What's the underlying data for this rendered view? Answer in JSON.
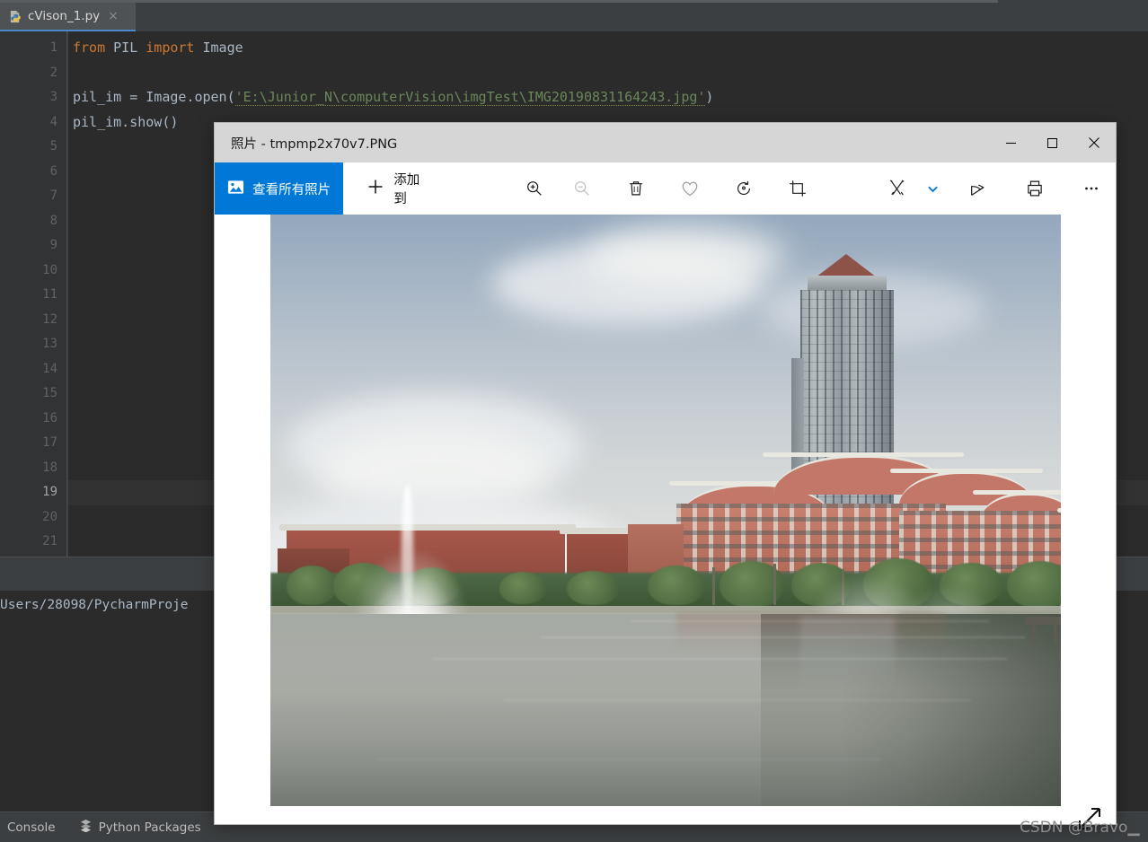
{
  "ide": {
    "tab": {
      "label": "cVison_1.py",
      "icon": "python-file-icon",
      "close_label": "×"
    },
    "editor": {
      "line_numbers": [
        "1",
        "2",
        "3",
        "4",
        "5",
        "6",
        "7",
        "8",
        "9",
        "10",
        "11",
        "12",
        "13",
        "14",
        "15",
        "16",
        "17",
        "18",
        "19",
        "20",
        "21"
      ],
      "current_line": "19",
      "lines": [
        {
          "n": 1,
          "parts": [
            {
              "t": "from ",
              "c": "kw"
            },
            {
              "t": "PIL ",
              "c": "pl"
            },
            {
              "t": "import ",
              "c": "kw"
            },
            {
              "t": "Image",
              "c": "pl"
            }
          ]
        },
        {
          "n": 3,
          "parts": [
            {
              "t": "pil_im = Image.open(",
              "c": "pl"
            },
            {
              "t": "'E:\\Junior_N\\computerVision\\imgTest\\IMG20190831164243.jpg'",
              "c": "str"
            },
            {
              "t": ")",
              "c": "pl"
            }
          ]
        },
        {
          "n": 4,
          "parts": [
            {
              "t": "pil_im.show()",
              "c": "pl"
            }
          ]
        }
      ]
    },
    "console": {
      "output": "Users/28098/PycharmProje"
    },
    "statusbar": {
      "items": [
        {
          "label": "Console",
          "icon": ""
        },
        {
          "label": "Python Packages",
          "icon": "packages-icon"
        }
      ]
    }
  },
  "photos_window": {
    "title": "照片 - tmpmp2x70v7.PNG",
    "window_controls": [
      {
        "name": "minimize",
        "glyph": "—"
      },
      {
        "name": "maximize",
        "glyph": "☐"
      },
      {
        "name": "close",
        "glyph": "✕"
      }
    ],
    "toolbar": {
      "view_all_label": "查看所有照片",
      "view_all_icon": "photo-gallery-icon",
      "add_to_label": "添加到",
      "add_to_icon": "plus-icon",
      "icons": [
        {
          "name": "zoom-in-icon",
          "state": "enabled"
        },
        {
          "name": "zoom-out-icon",
          "state": "disabled"
        },
        {
          "name": "delete-icon",
          "state": "enabled"
        },
        {
          "name": "favorite-heart-icon",
          "state": "enabled"
        },
        {
          "name": "rotate-icon",
          "state": "enabled"
        },
        {
          "name": "crop-icon",
          "state": "enabled"
        },
        {
          "name": "edit-draw-icon",
          "state": "enabled"
        },
        {
          "name": "chevron-down-icon",
          "state": "enabled"
        },
        {
          "name": "share-icon",
          "state": "enabled"
        },
        {
          "name": "print-icon",
          "state": "enabled"
        },
        {
          "name": "more-options-icon",
          "state": "enabled"
        }
      ]
    },
    "photo": {
      "alt": "Xiamen University campus lake with high-rise tower, traditional red-roofed buildings, fountain and reflections"
    }
  },
  "watermark": {
    "text": "CSDN @Bravo▁"
  },
  "colors": {
    "accent_blue": "#0078d7",
    "ide_panel": "#3c3f41",
    "editor_bg": "#2b2b2b",
    "gutter_bg": "#313335",
    "titlebar_bg": "#d6d6d6",
    "code_keyword": "#cc7832",
    "code_string": "#6a8759",
    "code_plain": "#a9b7c6"
  }
}
